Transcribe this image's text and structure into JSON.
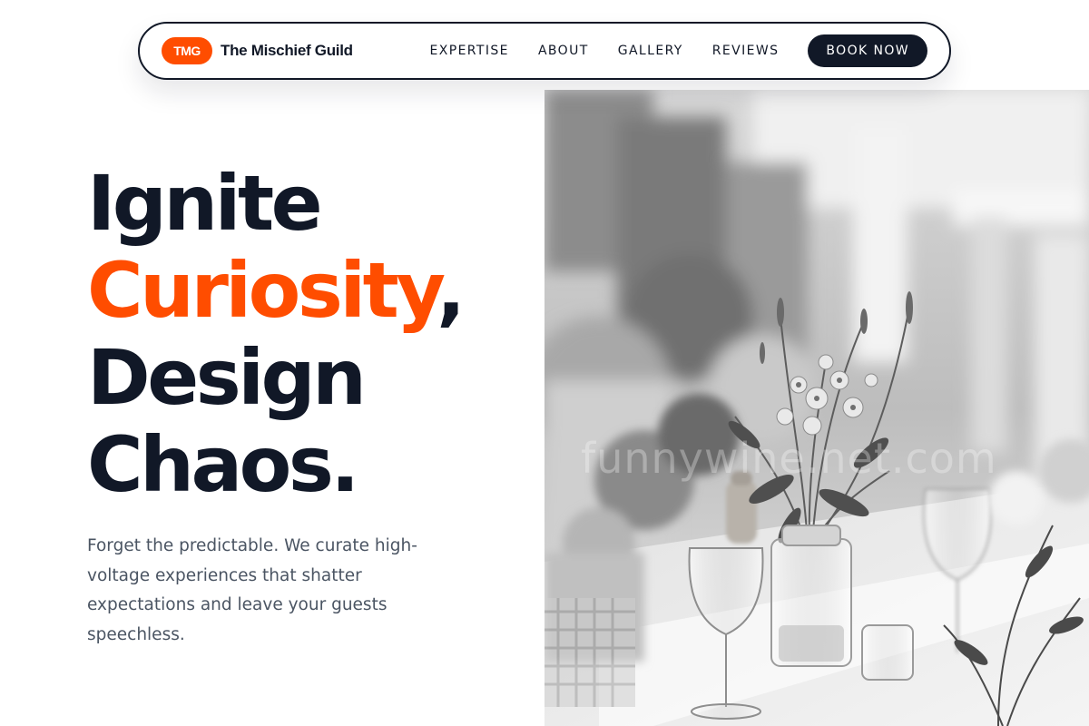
{
  "nav": {
    "logo_badge": "TMG",
    "brand_name": "The Mischief Guild",
    "links": [
      "EXPERTISE",
      "ABOUT",
      "GALLERY",
      "REVIEWS"
    ],
    "cta_label": "BOOK NOW"
  },
  "hero": {
    "title_line1": "Ignite",
    "title_accent": "Curiosity",
    "title_accent_punct": ",",
    "title_line3": "Design",
    "title_line4": "Chaos.",
    "subtitle": "Forget the predictable. We curate high-voltage experiences that shatter expectations and leave your guests speechless."
  },
  "photo": {
    "watermark": "funnywine.net.com"
  },
  "colors": {
    "accent": "#ff4d00",
    "ink": "#111827",
    "muted": "#4b5563"
  }
}
